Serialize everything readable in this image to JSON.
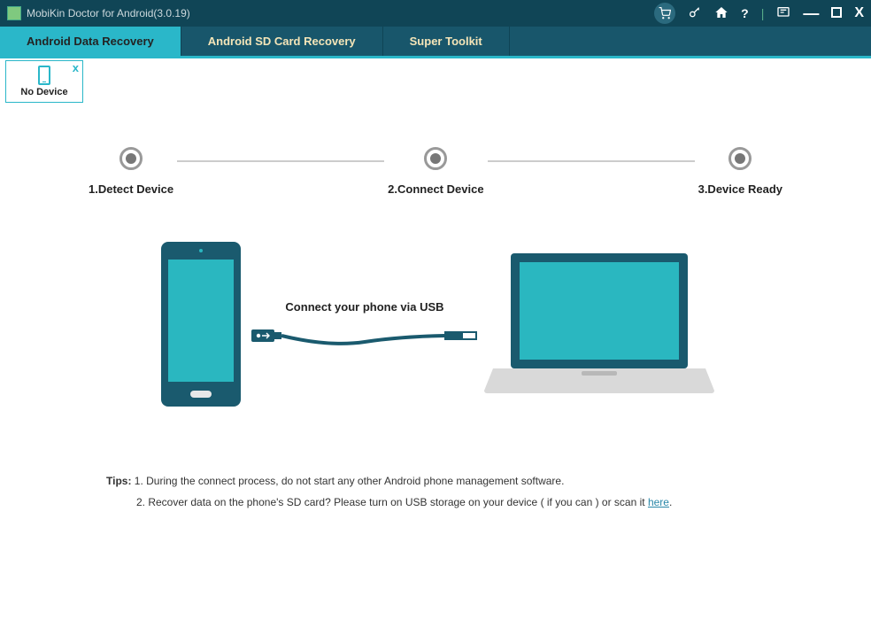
{
  "titlebar": {
    "title": "MobiKin Doctor for Android(3.0.19)"
  },
  "nav": {
    "tabs": [
      {
        "label": "Android Data Recovery"
      },
      {
        "label": "Android SD Card Recovery"
      },
      {
        "label": "Super Toolkit"
      }
    ]
  },
  "deviceTab": {
    "label": "No Device",
    "close": "x"
  },
  "steps": [
    {
      "label": "1.Detect Device"
    },
    {
      "label": "2.Connect Device"
    },
    {
      "label": "3.Device Ready"
    }
  ],
  "illustration": {
    "cableLabel": "Connect your phone via USB"
  },
  "tips": {
    "label": "Tips:",
    "line1": " 1. During the connect process, do not start any other Android phone management software.",
    "line2prefix": "2. Recover data on the phone's SD card? Please turn on USB storage on your device ( if you can ) or scan it ",
    "hereLink": "here",
    "line2suffix": "."
  }
}
